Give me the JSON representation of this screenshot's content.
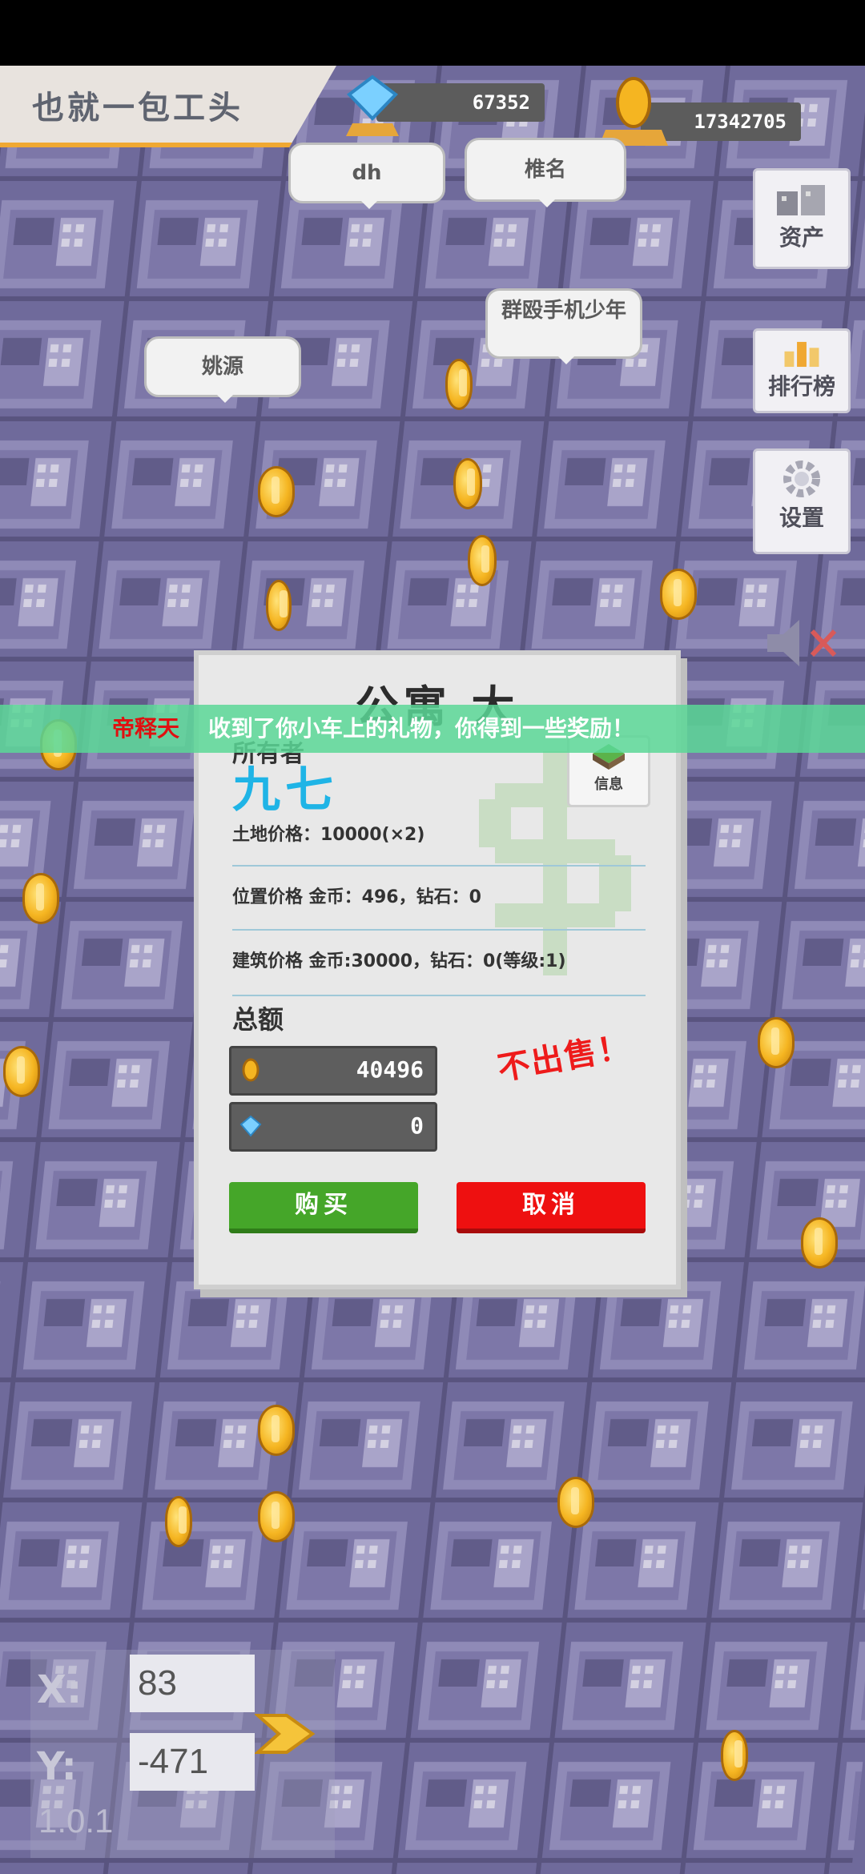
{
  "player": {
    "name": "也就一包工头"
  },
  "resources": {
    "diamonds": "67352",
    "coins": "17342705"
  },
  "bubbles": [
    {
      "id": "dh",
      "text": "dh"
    },
    {
      "id": "nick",
      "text": "椎名"
    },
    {
      "id": "group",
      "text": "群殴手机少年"
    },
    {
      "id": "yao",
      "text": "姚源"
    }
  ],
  "side_menu": {
    "assets": "资产",
    "leaderboard": "排行榜",
    "settings": "设置"
  },
  "notice": {
    "sender": "帝释天",
    "message": "收到了你小车上的礼物，你得到一些奖励！"
  },
  "dialog": {
    "title": "公寓 大",
    "owner_label": "所有者",
    "owner_name": "九七",
    "info_label": "信息",
    "land_price": "土地价格：10000(×2)",
    "location_price": "位置价格 金币：496，钻石：0",
    "building_price": "建筑价格 金币:30000，钻石：0(等级:1)",
    "total_label": "总额",
    "total_coins": "40496",
    "total_diamonds": "0",
    "not_for_sale": "不出售！",
    "buy_label": "购买",
    "cancel_label": "取消"
  },
  "coords": {
    "x_label": "X:",
    "y_label": "Y:",
    "x_value": "83",
    "y_value": "-471"
  },
  "version": "1.0.1",
  "colors": {
    "accent": "#f0a832",
    "owner": "#1fb4e6",
    "buy": "#45a629",
    "cancel": "#ee1010",
    "notice": "#5ad796"
  }
}
